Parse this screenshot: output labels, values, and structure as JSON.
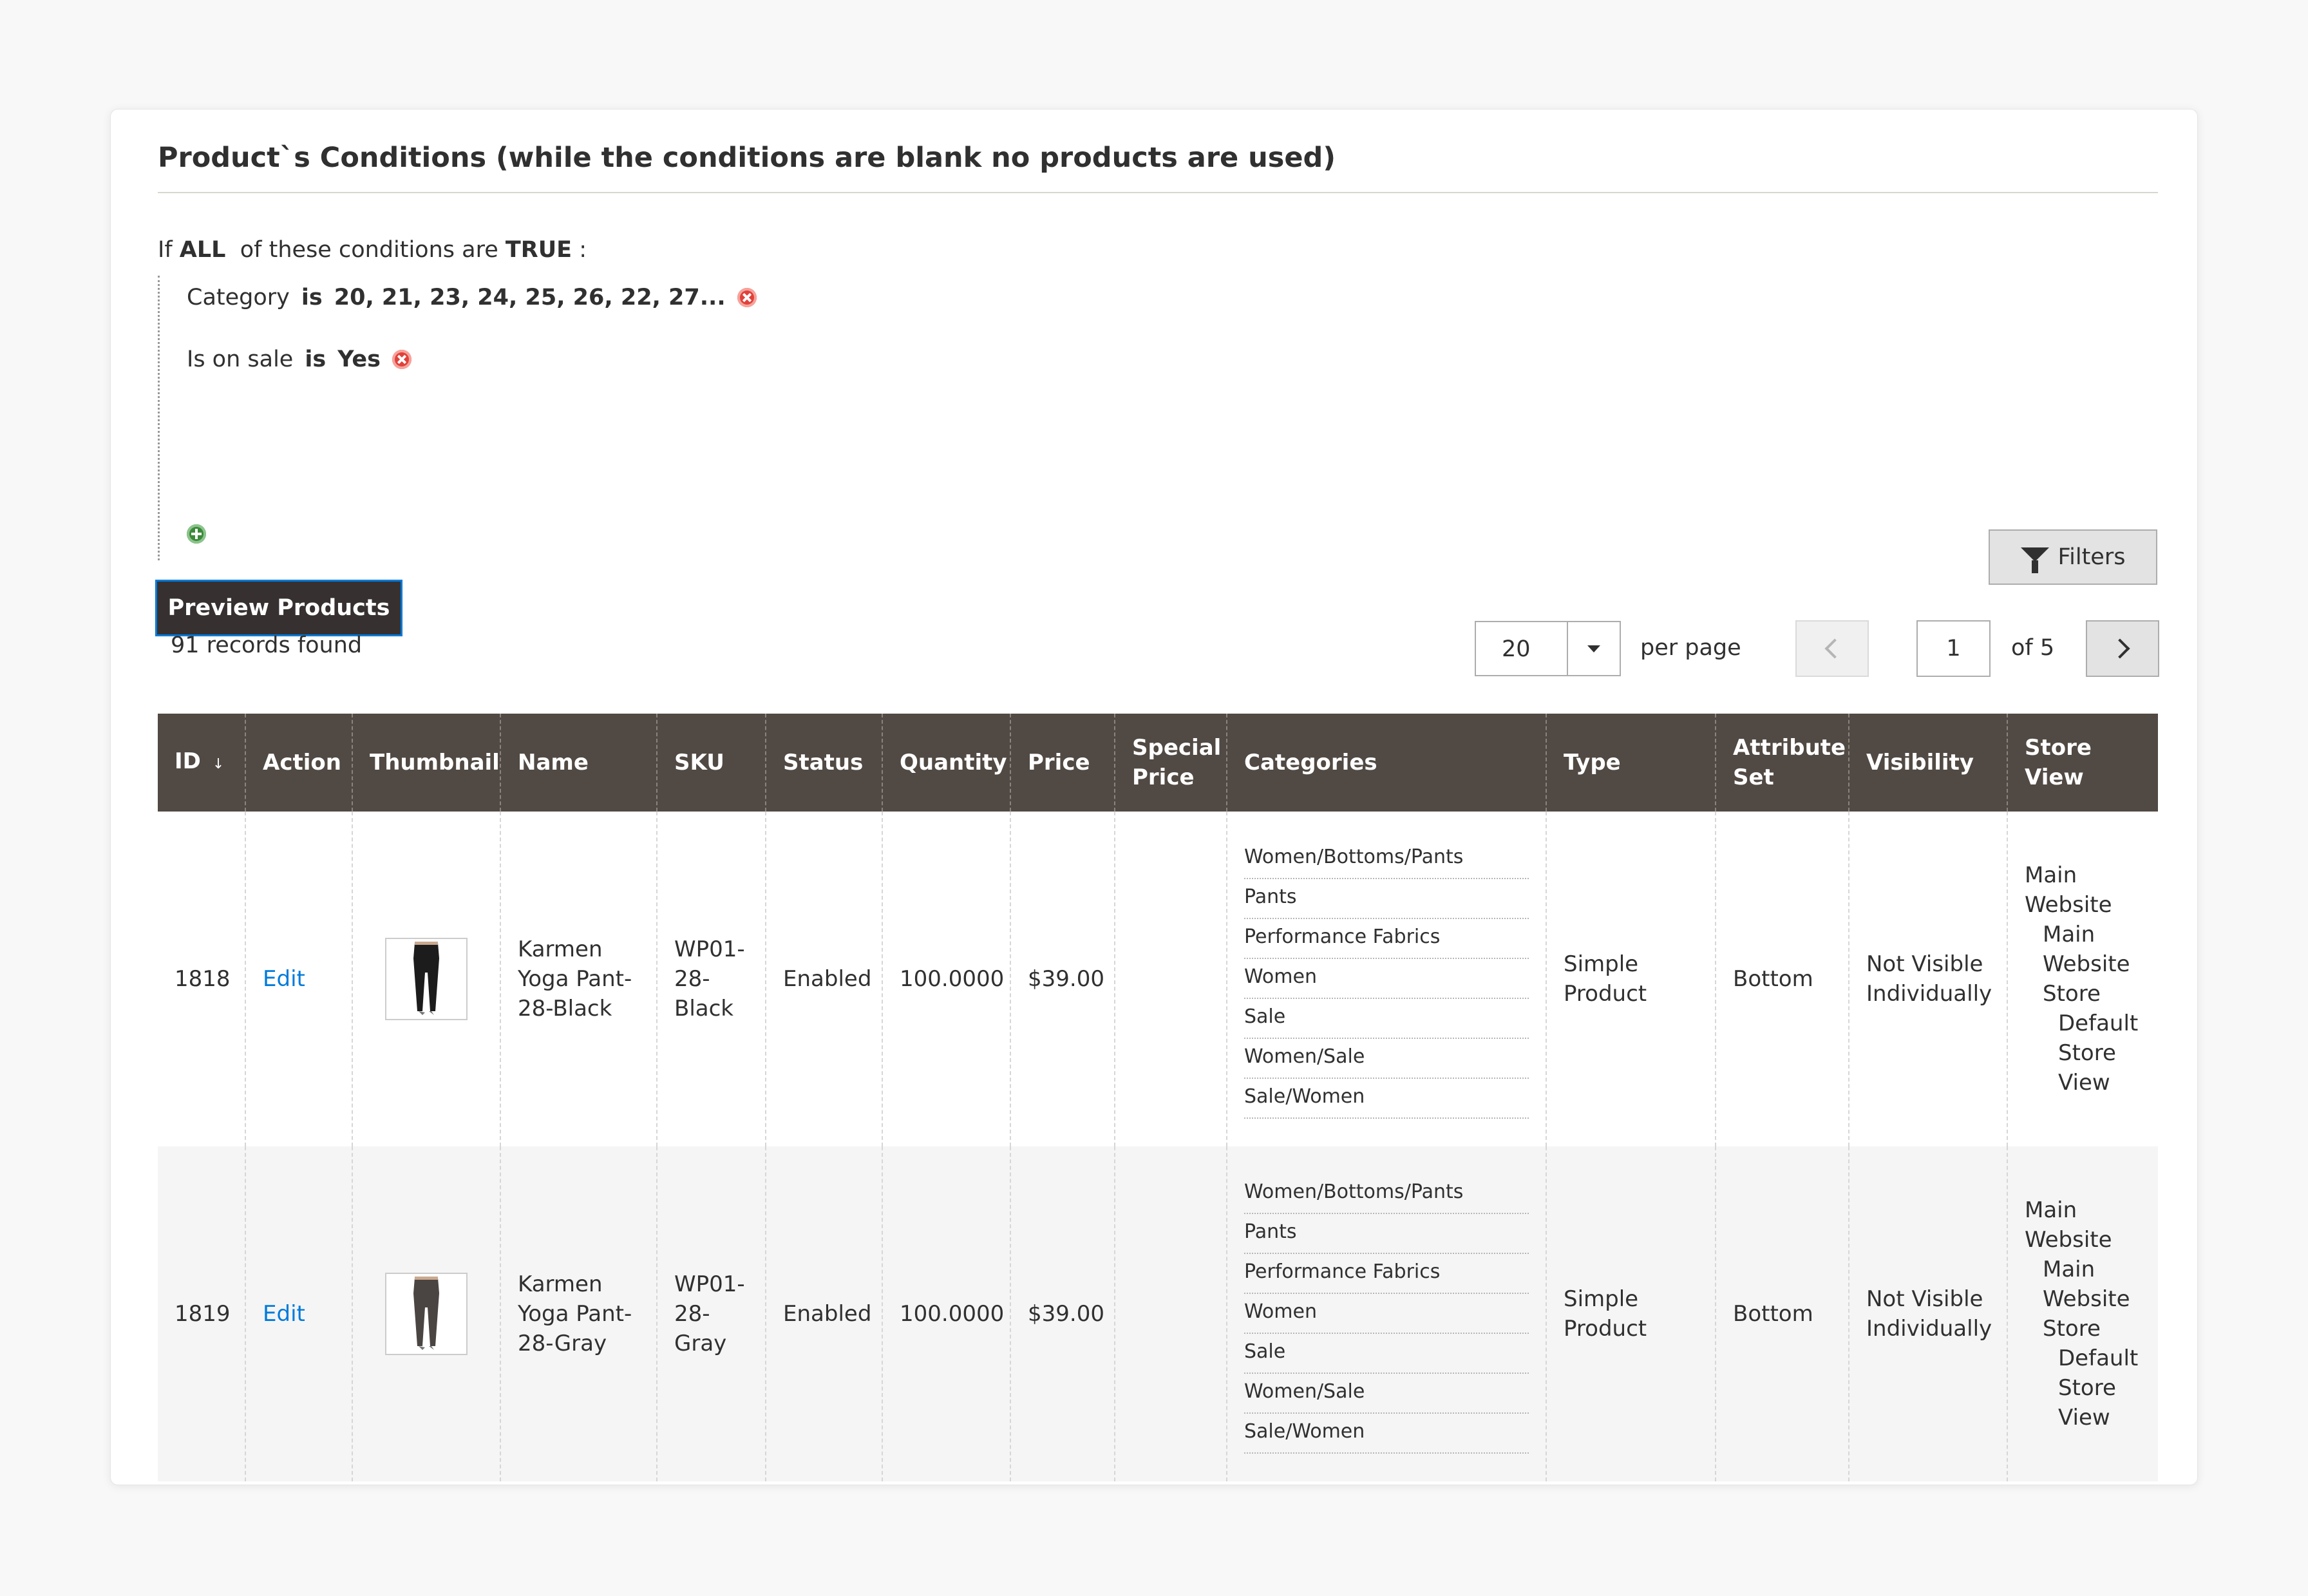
{
  "section": {
    "title": "Product`s Conditions (while the conditions are blank no products are used)"
  },
  "conditions": {
    "if_label": "If",
    "aggregator": "ALL",
    "of_label": "of these conditions are",
    "value": "TRUE",
    "colon": ":",
    "rules": [
      {
        "attribute": "Category",
        "operator": "is",
        "value": "20, 21, 23, 24, 25, 26, 22, 27..."
      },
      {
        "attribute": "Is on sale",
        "operator": "is",
        "value": "Yes"
      }
    ]
  },
  "buttons": {
    "preview": "Preview Products",
    "filters": "Filters"
  },
  "pagination": {
    "records": "91 records found",
    "per_page_value": "20",
    "per_page_label": "per page",
    "current_page": "1",
    "of_pages": "of 5"
  },
  "table": {
    "columns": [
      "ID",
      "Action",
      "Thumbnail",
      "Name",
      "SKU",
      "Status",
      "Quantity",
      "Price",
      "Special Price",
      "Categories",
      "Type",
      "Attribute Set",
      "Visibility",
      "Store View"
    ],
    "sort_indicator": "↓",
    "rows": [
      {
        "id": "1818",
        "action": "Edit",
        "name": "Karmen Yoga Pant-28-Black",
        "sku": "WP01-28-Black",
        "status": "Enabled",
        "quantity": "100.0000",
        "price": "$39.00",
        "special_price": "",
        "categories": [
          "Women/Bottoms/Pants",
          "Pants",
          "Performance Fabrics",
          "Women",
          "Sale",
          "Women/Sale",
          "Sale/Women"
        ],
        "type": "Simple Product",
        "attribute_set": "Bottom",
        "visibility": "Not Visible Individually",
        "store_view": [
          "Main Website",
          "Main Website Store",
          "Default Store View"
        ],
        "pant_color": "#1c1c1c"
      },
      {
        "id": "1819",
        "action": "Edit",
        "name": "Karmen Yoga Pant-28-Gray",
        "sku": "WP01-28-Gray",
        "status": "Enabled",
        "quantity": "100.0000",
        "price": "$39.00",
        "special_price": "",
        "categories": [
          "Women/Bottoms/Pants",
          "Pants",
          "Performance Fabrics",
          "Women",
          "Sale",
          "Women/Sale",
          "Sale/Women"
        ],
        "type": "Simple Product",
        "attribute_set": "Bottom",
        "visibility": "Not Visible Individually",
        "store_view": [
          "Main Website",
          "Main Website Store",
          "Default Store View"
        ],
        "pant_color": "#4a4542"
      }
    ]
  }
}
